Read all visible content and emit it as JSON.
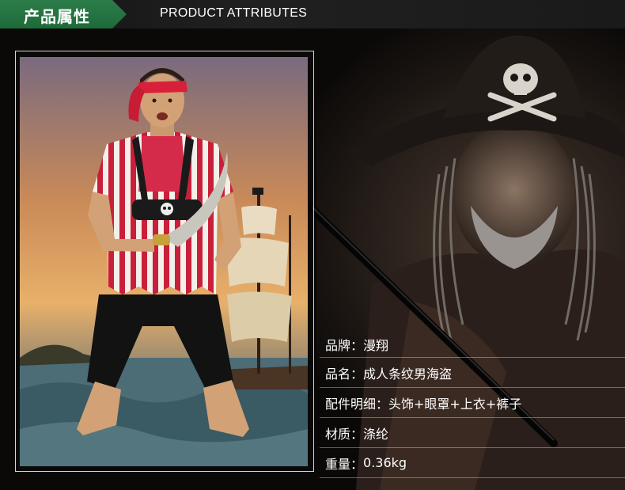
{
  "header": {
    "title_cn": "产品属性",
    "title_en": "PRODUCT ATTRIBUTES"
  },
  "attributes": [
    {
      "label": "品牌：",
      "value": "漫翔"
    },
    {
      "label": "品名：",
      "value": "成人条纹男海盗"
    },
    {
      "label": "配件明细：",
      "value": "头饰+眼罩+上衣+裤子"
    },
    {
      "label": "材质：",
      "value": "涤纶"
    },
    {
      "label": "重量：",
      "value": "0.36kg"
    }
  ],
  "colors": {
    "header_tab": "#2c7d4a",
    "text": "#ffffff",
    "divider": "#8a8a8a"
  }
}
